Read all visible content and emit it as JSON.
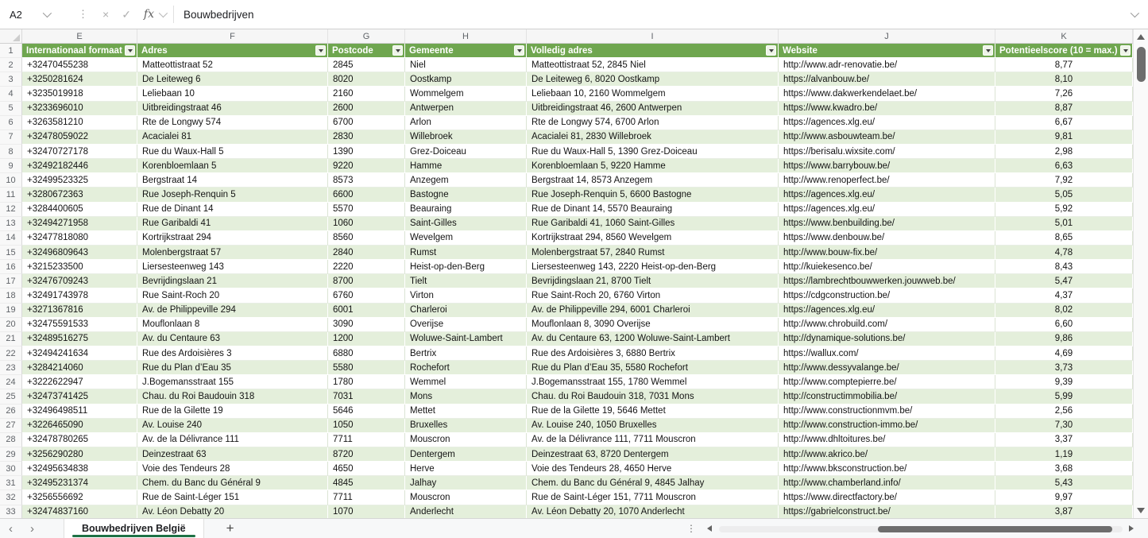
{
  "colors": {
    "header_green": "#6FA64F",
    "band_green": "#E4EFDB",
    "tab_green": "#1E7145"
  },
  "formula_bar": {
    "name_box": "A2",
    "cancel_label": "×",
    "enter_label": "✓",
    "fx_label": "fx",
    "formula": "Bouwbedrijven"
  },
  "sheet": {
    "column_letters": [
      "E",
      "F",
      "G",
      "H",
      "I",
      "J",
      "K"
    ],
    "header_row_number": 1,
    "first_data_row": 2,
    "headers": [
      "Internationaal formaat",
      "Adres",
      "Postcode",
      "Gemeente",
      "Volledig adres",
      "Website",
      "Potentieelscore (10 = max.)"
    ],
    "rows": [
      [
        "+32470455238",
        "Matteottistraat 52",
        "2845",
        "Niel",
        "Matteottistraat 52, 2845 Niel",
        "http://www.adr-renovatie.be/",
        "8,77"
      ],
      [
        "+3250281624",
        "De Leiteweg 6",
        "8020",
        "Oostkamp",
        "De Leiteweg 6, 8020 Oostkamp",
        "https://alvanbouw.be/",
        "8,10"
      ],
      [
        "+3235019918",
        "Leliebaan 10",
        "2160",
        "Wommelgem",
        "Leliebaan 10, 2160 Wommelgem",
        "https://www.dakwerkendelaet.be/",
        "7,26"
      ],
      [
        "+3233696010",
        "Uitbreidingstraat 46",
        "2600",
        "Antwerpen",
        "Uitbreidingstraat 46, 2600 Antwerpen",
        "https://www.kwadro.be/",
        "8,87"
      ],
      [
        "+3263581210",
        "Rte de Longwy 574",
        "6700",
        "Arlon",
        "Rte de Longwy 574, 6700 Arlon",
        "https://agences.xlg.eu/",
        "6,67"
      ],
      [
        "+32478059022",
        "Acacialei 81",
        "2830",
        "Willebroek",
        "Acacialei 81, 2830 Willebroek",
        "http://www.asbouwteam.be/",
        "9,81"
      ],
      [
        "+32470727178",
        "Rue du Waux-Hall 5",
        "1390",
        "Grez-Doiceau",
        "Rue du Waux-Hall 5, 1390 Grez-Doiceau",
        "https://berisalu.wixsite.com/",
        "2,98"
      ],
      [
        "+32492182446",
        "Korenbloemlaan 5",
        "9220",
        "Hamme",
        "Korenbloemlaan 5, 9220 Hamme",
        "https://www.barrybouw.be/",
        "6,63"
      ],
      [
        "+32499523325",
        "Bergstraat 14",
        "8573",
        "Anzegem",
        "Bergstraat 14, 8573 Anzegem",
        "http://www.renoperfect.be/",
        "7,92"
      ],
      [
        "+3280672363",
        "Rue Joseph-Renquin 5",
        "6600",
        "Bastogne",
        "Rue Joseph-Renquin 5, 6600 Bastogne",
        "https://agences.xlg.eu/",
        "5,05"
      ],
      [
        "+3284400605",
        "Rue de Dinant 14",
        "5570",
        "Beauraing",
        "Rue de Dinant 14, 5570 Beauraing",
        "https://agences.xlg.eu/",
        "5,92"
      ],
      [
        "+32494271958",
        "Rue Garibaldi 41",
        "1060",
        "Saint-Gilles",
        "Rue Garibaldi 41, 1060 Saint-Gilles",
        "https://www.benbuilding.be/",
        "5,01"
      ],
      [
        "+32477818080",
        "Kortrijkstraat 294",
        "8560",
        "Wevelgem",
        "Kortrijkstraat 294, 8560 Wevelgem",
        "https://www.denbouw.be/",
        "8,65"
      ],
      [
        "+32496809643",
        "Molenbergstraat 57",
        "2840",
        "Rumst",
        "Molenbergstraat 57, 2840 Rumst",
        "http://www.bouw-fix.be/",
        "4,78"
      ],
      [
        "+3215233500",
        "Liersesteenweg 143",
        "2220",
        "Heist-op-den-Berg",
        "Liersesteenweg 143, 2220 Heist-op-den-Berg",
        "http://kuiekesenco.be/",
        "8,43"
      ],
      [
        "+32476709243",
        "Bevrijdingslaan 21",
        "8700",
        "Tielt",
        "Bevrijdingslaan 21, 8700 Tielt",
        "https://lambrechtbouwwerken.jouwweb.be/",
        "5,47"
      ],
      [
        "+32491743978",
        "Rue Saint-Roch 20",
        "6760",
        "Virton",
        "Rue Saint-Roch 20, 6760 Virton",
        "https://cdgconstruction.be/",
        "4,37"
      ],
      [
        "+3271367816",
        "Av. de Philippeville 294",
        "6001",
        "Charleroi",
        "Av. de Philippeville 294, 6001 Charleroi",
        "https://agences.xlg.eu/",
        "8,02"
      ],
      [
        "+32475591533",
        "Mouflonlaan 8",
        "3090",
        "Overijse",
        "Mouflonlaan 8, 3090 Overijse",
        "http://www.chrobuild.com/",
        "6,60"
      ],
      [
        "+32489516275",
        "Av. du Centaure 63",
        "1200",
        "Woluwe-Saint-Lambert",
        "Av. du Centaure 63, 1200 Woluwe-Saint-Lambert",
        "http://dynamique-solutions.be/",
        "9,86"
      ],
      [
        "+32494241634",
        "Rue des Ardoisières 3",
        "6880",
        "Bertrix",
        "Rue des Ardoisières 3, 6880 Bertrix",
        "https://wallux.com/",
        "4,69"
      ],
      [
        "+3284214060",
        "Rue du Plan d’Eau 35",
        "5580",
        "Rochefort",
        "Rue du Plan d’Eau 35, 5580 Rochefort",
        "http://www.dessyvalange.be/",
        "3,73"
      ],
      [
        "+3222622947",
        "J.Bogemansstraat 155",
        "1780",
        "Wemmel",
        "J.Bogemansstraat 155, 1780 Wemmel",
        "http://www.comptepierre.be/",
        "9,39"
      ],
      [
        "+32473741425",
        "Chau. du Roi Baudouin 318",
        "7031",
        "Mons",
        "Chau. du Roi Baudouin 318, 7031 Mons",
        "http://constructimmobilia.be/",
        "5,99"
      ],
      [
        "+32496498511",
        "Rue de la Gilette 19",
        "5646",
        "Mettet",
        "Rue de la Gilette 19, 5646 Mettet",
        "http://www.constructionmvm.be/",
        "2,56"
      ],
      [
        "+3226465090",
        "Av. Louise 240",
        "1050",
        "Bruxelles",
        "Av. Louise 240, 1050 Bruxelles",
        "http://www.construction-immo.be/",
        "7,30"
      ],
      [
        "+32478780265",
        "Av. de la Délivrance 111",
        "7711",
        "Mouscron",
        "Av. de la Délivrance 111, 7711 Mouscron",
        "http://www.dhltoitures.be/",
        "3,37"
      ],
      [
        "+3256290280",
        "Deinzestraat 63",
        "8720",
        "Dentergem",
        "Deinzestraat 63, 8720 Dentergem",
        "http://www.akrico.be/",
        "1,19"
      ],
      [
        "+32495634838",
        "Voie des Tendeurs 28",
        "4650",
        "Herve",
        "Voie des Tendeurs 28, 4650 Herve",
        "http://www.bksconstruction.be/",
        "3,68"
      ],
      [
        "+32495231374",
        "Chem. du Banc du Général 9",
        "4845",
        "Jalhay",
        "Chem. du Banc du Général 9, 4845 Jalhay",
        "http://www.chamberland.info/",
        "5,43"
      ],
      [
        "+3256556692",
        "Rue de Saint-Léger 151",
        "7711",
        "Mouscron",
        "Rue de Saint-Léger 151, 7711 Mouscron",
        "https://www.directfactory.be/",
        "9,97"
      ],
      [
        "+32474837160",
        "Av. Léon Debatty 20",
        "1070",
        "Anderlecht",
        "Av. Léon Debatty 20, 1070 Anderlecht",
        "https://gabrielconstruct.be/",
        "3,87"
      ]
    ]
  },
  "bottom_bar": {
    "sheet_tab": "Bouwbedrijven België",
    "add_sheet_label": "+",
    "prev_label": "‹",
    "next_label": "›"
  }
}
